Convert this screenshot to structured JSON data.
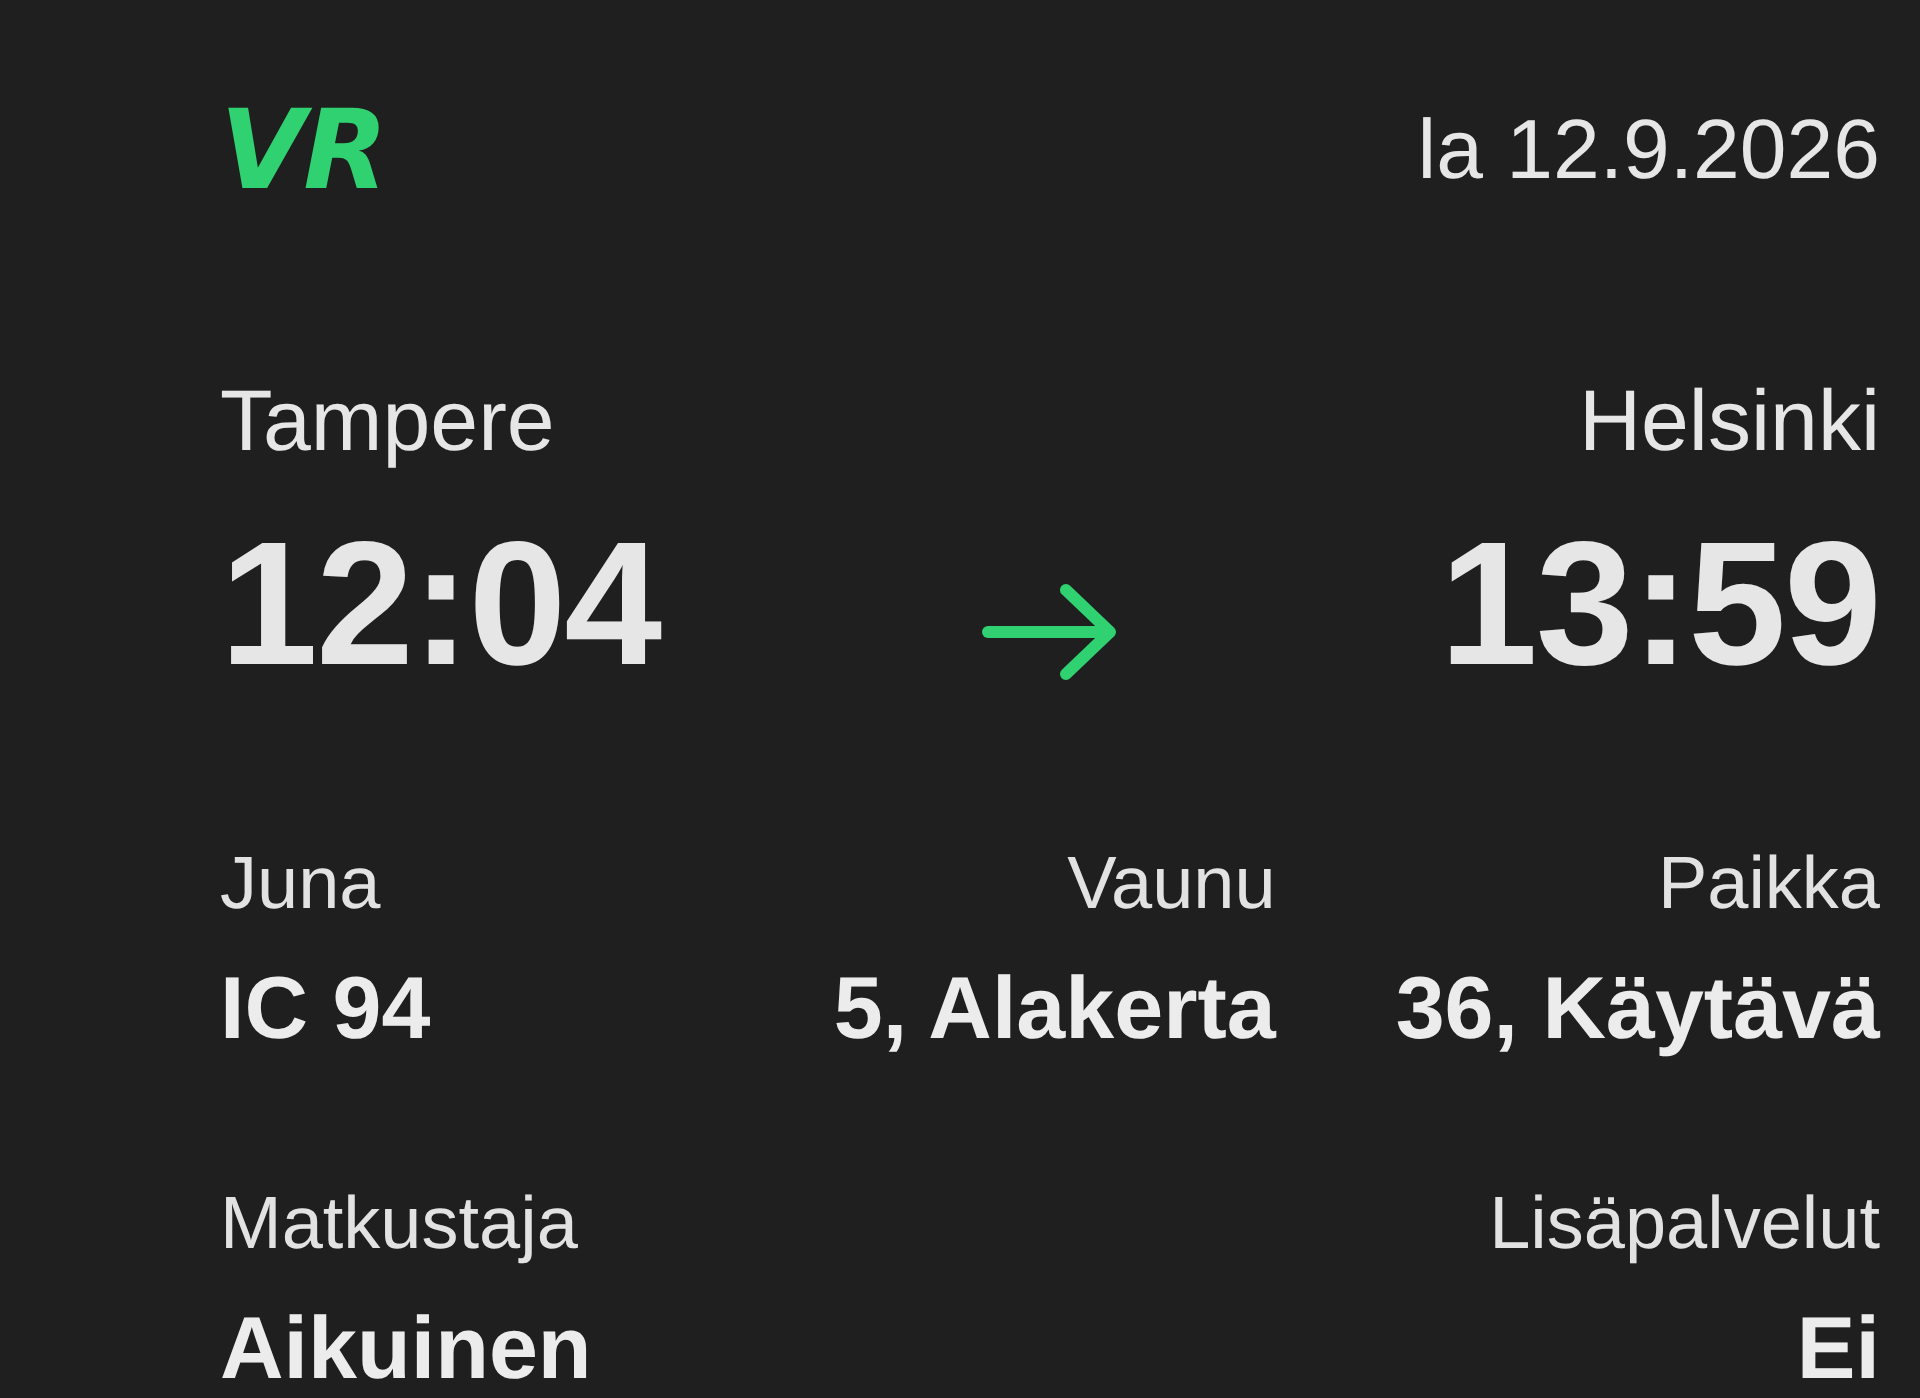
{
  "header": {
    "logo": "VR",
    "date": "la 12.9.2026"
  },
  "journey": {
    "departure": {
      "station": "Tampere",
      "time": "12:04"
    },
    "arrival": {
      "station": "Helsinki",
      "time": "13:59"
    }
  },
  "details": [
    {
      "label": "Juna",
      "value": "IC 94"
    },
    {
      "label": "Vaunu",
      "value": "5, Alakerta"
    },
    {
      "label": "Paikka",
      "value": "36, Käytävä"
    }
  ],
  "extras": [
    {
      "label": "Matkustaja",
      "value": "Aikuinen"
    },
    {
      "label": "Lisäpalvelut",
      "value": "Ei"
    }
  ]
}
